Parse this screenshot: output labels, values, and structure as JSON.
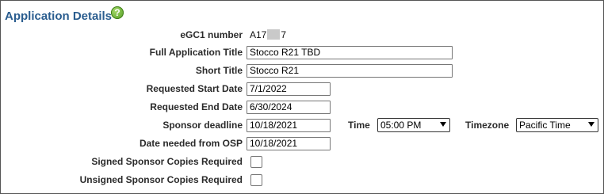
{
  "section": {
    "title": "Application Details",
    "help_icon_glyph": "?"
  },
  "fields": {
    "egc1": {
      "label": "eGC1 number",
      "value_prefix": "A17",
      "value_suffix": "7"
    },
    "full_title": {
      "label": "Full Application Title",
      "value": "Stocco R21 TBD"
    },
    "short_title": {
      "label": "Short Title",
      "value": "Stocco R21"
    },
    "start_date": {
      "label": "Requested Start Date",
      "value": "7/1/2022"
    },
    "end_date": {
      "label": "Requested End Date",
      "value": "6/30/2024"
    },
    "sponsor_deadline": {
      "label": "Sponsor deadline",
      "value": "10/18/2021",
      "time_label": "Time",
      "time_value": "05:00 PM",
      "timezone_label": "Timezone",
      "timezone_value": "Pacific Time"
    },
    "date_needed": {
      "label": "Date needed from OSP",
      "value": "10/18/2021"
    },
    "signed_copies": {
      "label": "Signed Sponsor Copies Required",
      "checked": false
    },
    "unsigned_copies": {
      "label": "Unsigned Sponsor Copies Required",
      "checked": false
    }
  },
  "colors": {
    "title": "#2a5d8f",
    "help_icon": "#5aa52a"
  }
}
